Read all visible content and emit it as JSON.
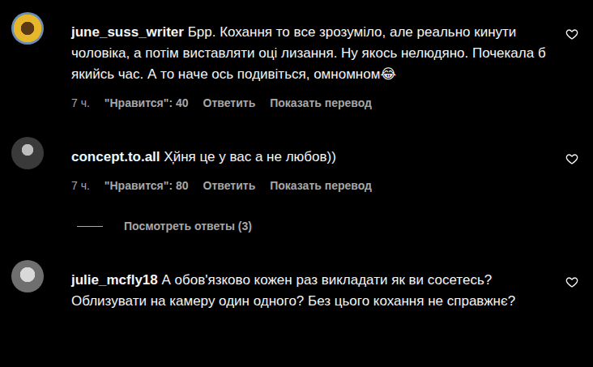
{
  "comments": [
    {
      "username": "june_suss_writer",
      "text": "Брр. Кохання то все зрозуміло, але реально кинути чоловіка, а потім виставляти оці лизання. Ну якось нелюдяно. Почекала б якийсь час. А то наче ось подивіться, омномном😂",
      "liked": false,
      "meta": {
        "time": "7 ч.",
        "likes": "\"Нравится\": 40",
        "reply": "Ответить",
        "translate": "Показать перевод"
      },
      "replies": null
    },
    {
      "username": "concept.to.all",
      "text": "Х̦йня це у вас а не любов))",
      "liked": false,
      "meta": {
        "time": "7 ч.",
        "likes": "\"Нравится\": 80",
        "reply": "Ответить",
        "translate": "Показать перевод"
      },
      "replies": "Посмотреть ответы (3)"
    },
    {
      "username": "julie_mcfly18",
      "text": "А обов'язково кожен раз викладати як ви сосетесь? Облизувати на камеру один одного? Без цього кохання не справжнє?",
      "liked": false,
      "meta": null,
      "replies": null
    }
  ]
}
